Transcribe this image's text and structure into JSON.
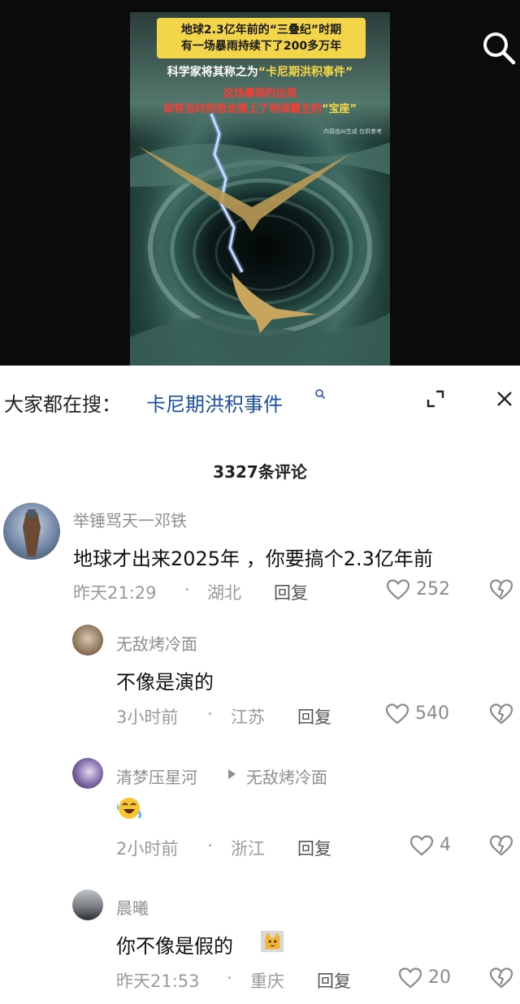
{
  "video": {
    "title_line1": "地球2.3亿年前的“三叠纪”时期",
    "title_line2": "有一场暴雨持续下了200多万年",
    "subtitle_line1_a": "科学家将其称之为",
    "subtitle_line1_b": "“卡尼期洪积事件”",
    "subtitle_line2": "这场暴雨的出现",
    "subtitle_line3_a": "却将当时的恐龙推上了地球霸主的",
    "subtitle_line3_b": "“宝座”",
    "credit": "内容由AI生成 仅供参考"
  },
  "search_suggest": {
    "label": "大家都在搜：",
    "term": "卡尼期洪积事件"
  },
  "comments_count": "3327条评论",
  "comments": [
    {
      "user": "举锤骂天一邓铁",
      "text": "地球才出来2025年 ，你要搞个2.3亿年前",
      "time": "昨天21:29",
      "dot": "·",
      "location": "湖北",
      "reply": "回复",
      "likes": "252"
    },
    {
      "user": "无敌烤冷面",
      "text": "不像是演的",
      "time": "3小时前",
      "dot": "·",
      "location": "江苏",
      "reply": "回复",
      "likes": "540"
    },
    {
      "user": "清梦压星河",
      "reply_to": "无敌烤冷面",
      "text": "",
      "time": "2小时前",
      "dot": "·",
      "location": "浙江",
      "reply": "回复",
      "likes": "4"
    },
    {
      "user": "晨曦",
      "text": "你不像是假的",
      "time": "昨天21:53",
      "dot": "·",
      "location": "重庆",
      "reply": "回复",
      "likes": "20"
    }
  ],
  "icons": {
    "search": "search-icon",
    "expand": "expand-icon",
    "close": "close-icon",
    "like": "heart-outline-icon",
    "dislike": "broken-heart-icon",
    "laugh_emoji": "laughing-crying-emoji",
    "cat_emoji": "cat-emoji"
  },
  "colors": {
    "link": "#1c4fa3",
    "title_box": "#f3d54a",
    "poster_red": "#ff3b30"
  }
}
